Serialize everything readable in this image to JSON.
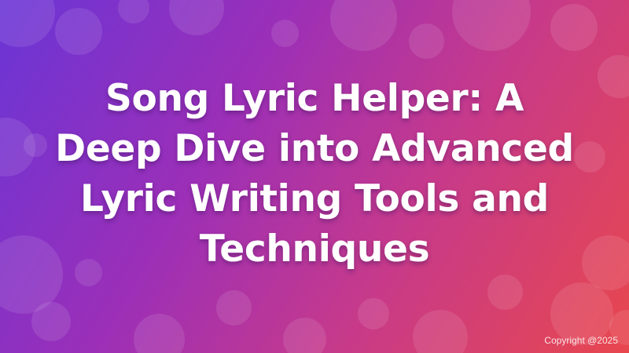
{
  "title": "Song Lyric Helper: A Deep Dive into Advanced Lyric Writing Tools and Techniques",
  "copyright": "Copyright @2025",
  "colors": {
    "gradient_start": "#6a35d6",
    "gradient_mid": "#c73a8a",
    "gradient_end": "#e8474d",
    "text": "#ffffff"
  }
}
